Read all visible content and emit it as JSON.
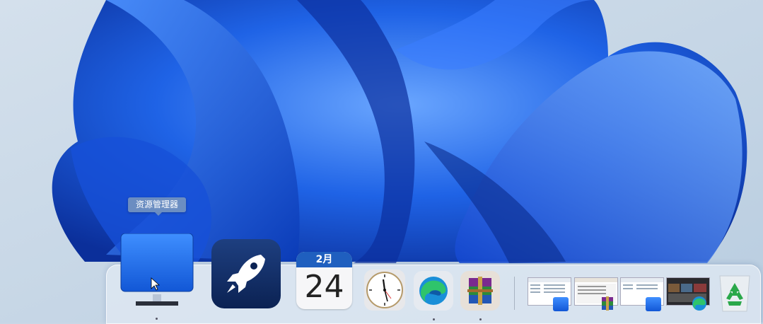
{
  "tooltip": {
    "text": "资源管理器"
  },
  "dock": {
    "items": [
      {
        "name": "explorer",
        "icon": "monitor-icon",
        "running": true
      },
      {
        "name": "launchpad",
        "icon": "rocket-icon",
        "running": false
      },
      {
        "name": "calendar",
        "icon": "calendar-icon",
        "month": "2月",
        "day": "24",
        "running": false
      },
      {
        "name": "clock",
        "icon": "clock-icon",
        "running": false
      },
      {
        "name": "edge",
        "icon": "edge-icon",
        "running": true
      },
      {
        "name": "winrar",
        "icon": "winrar-icon",
        "running": true
      }
    ],
    "minimized": [
      {
        "name": "explorer-window-1",
        "badge": "explorer-badge-icon"
      },
      {
        "name": "winrar-window",
        "badge": "winrar-badge-icon"
      },
      {
        "name": "explorer-window-2",
        "badge": "explorer-badge-icon"
      },
      {
        "name": "edge-window",
        "badge": "edge-badge-icon"
      }
    ],
    "trash": {
      "icon": "recycle-bin-icon"
    }
  },
  "colors": {
    "accent": "#1a6fe0",
    "wallpaper_bg": "#c9d7e6",
    "bloom": "#1d5fe8"
  }
}
